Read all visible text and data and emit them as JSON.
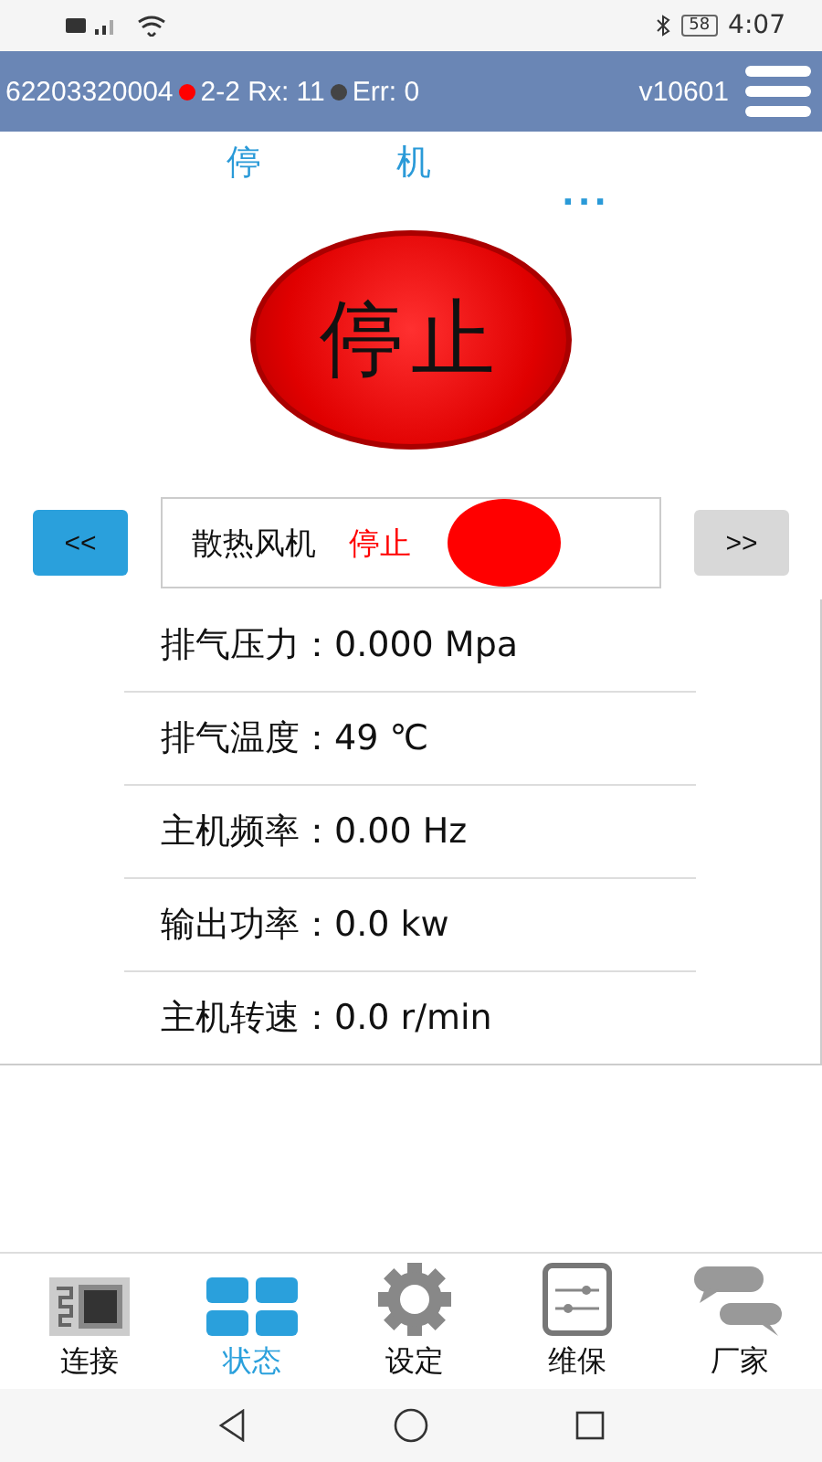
{
  "status_bar": {
    "time": "4:07",
    "battery": "58"
  },
  "header": {
    "device": "62203320004",
    "indicators": [
      {
        "color": "#ff0000",
        "text": "2-2 Rx: 11"
      },
      {
        "color": "#444444",
        "text": "Err: 0"
      }
    ],
    "version": "v10601"
  },
  "machine_state": {
    "chars": [
      "停",
      "机"
    ],
    "more": "..."
  },
  "main_button": {
    "label": "停止"
  },
  "component": {
    "prev": "<<",
    "next": ">>",
    "name": "散热风机",
    "status": "停止",
    "color": "#ff0000"
  },
  "readings": [
    {
      "label": "排气压力：",
      "value": "0.000 Mpa"
    },
    {
      "label": "排气温度：",
      "value": "49 ℃"
    },
    {
      "label": "主机频率：",
      "value": "0.00 Hz"
    },
    {
      "label": "输出功率：",
      "value": "0.0 kw"
    },
    {
      "label": "主机转速：",
      "value": "0.0 r/min"
    }
  ],
  "tabs": [
    {
      "label": "连接",
      "kind": "connect",
      "selected": false
    },
    {
      "label": "状态",
      "kind": "status",
      "selected": true
    },
    {
      "label": "设定",
      "kind": "settings",
      "selected": false
    },
    {
      "label": "维保",
      "kind": "maintain",
      "selected": false
    },
    {
      "label": "厂家",
      "kind": "vendor",
      "selected": false
    }
  ]
}
